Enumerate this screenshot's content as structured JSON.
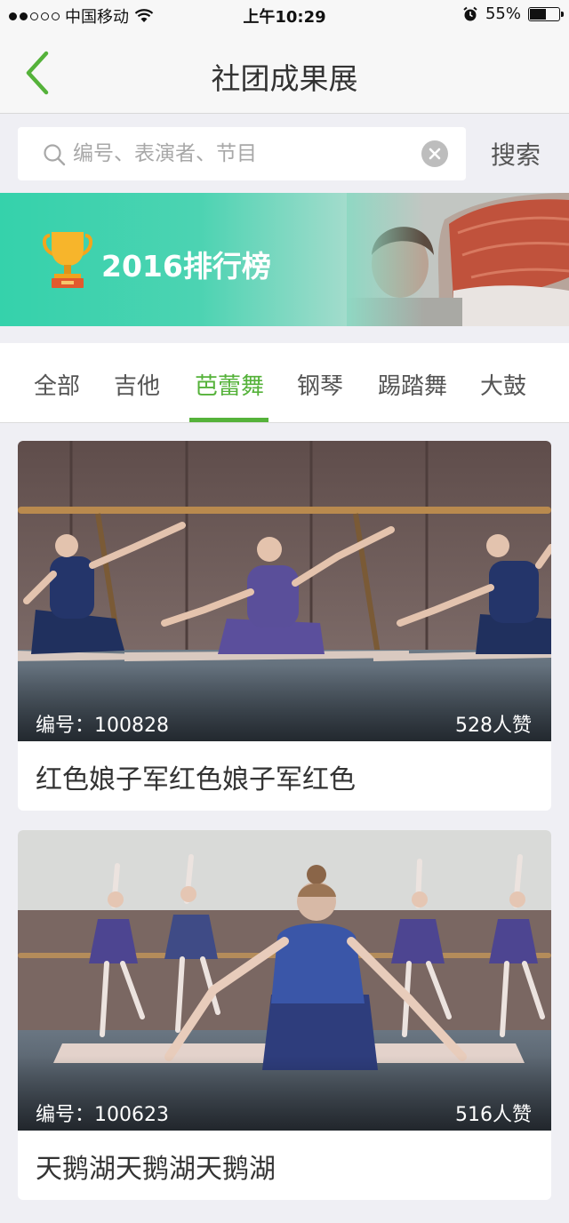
{
  "status_bar": {
    "carrier": "中国移动",
    "time": "上午10:29",
    "battery": "55%",
    "battery_level": 0.55,
    "signal_bars": 2,
    "icons": [
      "wifi-icon",
      "alarm-icon",
      "battery-icon"
    ]
  },
  "nav": {
    "title": "社团成果展",
    "back_icon": "chevron-left-icon"
  },
  "search": {
    "placeholder": "编号、表演者、节目",
    "value": "",
    "button_label": "搜索",
    "icons": [
      "search-icon",
      "clear-icon"
    ]
  },
  "banner": {
    "title": "2016排行榜",
    "icon": "trophy-icon"
  },
  "tabs": [
    {
      "label": "全部",
      "active": false
    },
    {
      "label": "吉他",
      "active": false
    },
    {
      "label": "芭蕾舞",
      "active": true
    },
    {
      "label": "钢琴",
      "active": false
    },
    {
      "label": "踢踏舞",
      "active": false
    },
    {
      "label": "大鼓",
      "active": false
    }
  ],
  "cards": [
    {
      "code": "编号：100828",
      "likes": "528人赞",
      "title": "红色娘子军红色娘子军红色"
    },
    {
      "code": "编号：100623",
      "likes": "516人赞",
      "title": "天鹅湖天鹅湖天鹅湖"
    }
  ],
  "colors": {
    "accent": "#55b23a",
    "banner_start": "#35d2ab",
    "banner_end": "#c9cdc8",
    "background": "#efeff4"
  }
}
